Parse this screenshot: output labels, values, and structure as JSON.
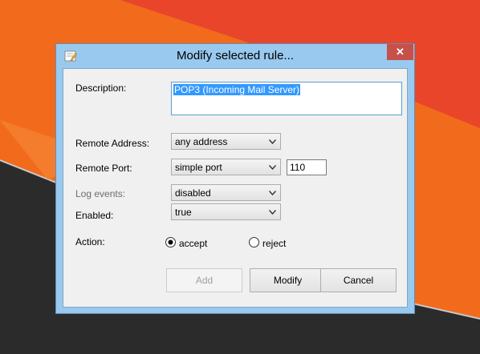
{
  "dialog": {
    "title": "Modify selected rule...",
    "close_glyph": "✕"
  },
  "form": {
    "description_label": "Description:",
    "description_value": "POP3 (Incoming Mail Server)",
    "remote_address_label": "Remote Address:",
    "remote_address_value": "any address",
    "remote_port_label": "Remote Port:",
    "remote_port_value": "simple port",
    "port_number": "110",
    "log_events_label": "Log events:",
    "log_events_value": "disabled",
    "enabled_label": "Enabled:",
    "enabled_value": "true",
    "action_label": "Action:",
    "action_options": [
      {
        "label": "accept",
        "selected": true
      },
      {
        "label": "reject",
        "selected": false
      }
    ]
  },
  "buttons": {
    "add_label": "Add",
    "modify_label": "Modify",
    "cancel_label": "Cancel"
  },
  "colors": {
    "titlebar": "#99c9ef",
    "close_button": "#c7504b",
    "selection": "#3399ff",
    "desktop_orange": "#f26a1b",
    "desktop_red": "#e8452a",
    "desktop_dark": "#2b2b2b"
  }
}
